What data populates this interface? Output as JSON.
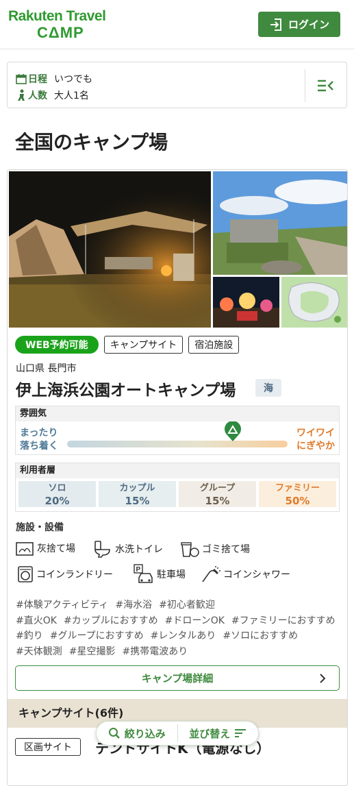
{
  "header": {
    "logo_line1": "Rakuten Travel",
    "logo_line2": "CΔMP",
    "login_label": "ログイン"
  },
  "search": {
    "date_key": "日程",
    "date_value": "いつでも",
    "people_key": "人数",
    "people_value": "大人1名"
  },
  "page_title": "全国のキャンプ場",
  "card": {
    "badges": [
      "WEB予約可能",
      "キャンプサイト",
      "宿泊施設"
    ],
    "location": "山口県 長門市",
    "name": "伊上海浜公園オートキャンプ場",
    "tag": "海",
    "atmosphere": {
      "title": "雰囲気",
      "left": "まったり",
      "left2": "落ち着く",
      "right": "ワイワイ",
      "right2": "にぎやか",
      "level": 0.75
    },
    "users": {
      "title": "利用者層",
      "cells": [
        {
          "name": "ソロ",
          "pct": "20%"
        },
        {
          "name": "カップル",
          "pct": "15%"
        },
        {
          "name": "グループ",
          "pct": "15%"
        },
        {
          "name": "ファミリー",
          "pct": "50%"
        }
      ]
    },
    "facilities_title": "施設・設備",
    "facilities": [
      "灰捨て場",
      "水洗トイレ",
      "ゴミ捨て場",
      "コインランドリー",
      "駐車場",
      "コインシャワー"
    ],
    "hashtags": [
      "#体験アクティビティ",
      "#海水浴",
      "#初心者歓迎",
      "#直火OK",
      "#カップルにおすすめ",
      "#ドローンOK",
      "#ファミリーにおすすめ",
      "#釣り",
      "#グループにおすすめ",
      "#レンタルあり",
      "#ソロにおすすめ",
      "#天体観測",
      "#星空撮影",
      "#携帯電波あり"
    ],
    "detail_label": "キャンプ場詳細"
  },
  "sites": {
    "header": "キャンプサイト(6件)",
    "first_tag": "区画サイト",
    "first_name": "テントサイトK（電源なし）"
  },
  "floating": {
    "filter_label": "絞り込み",
    "sort_label": "並び替え"
  },
  "colors": {
    "brand_green": "#3f8a3f",
    "web_badge": "#1aa31a",
    "lively_orange": "#e07b2b",
    "calm_blue": "#4f7a98"
  }
}
